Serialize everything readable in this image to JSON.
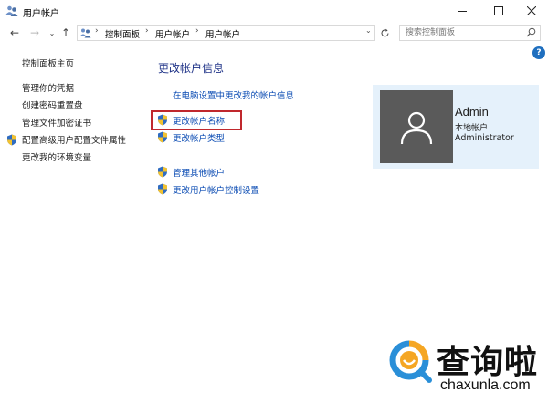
{
  "window": {
    "title": "用户帐户",
    "icons": {
      "app": "user-accounts-icon",
      "minimize": "minimize-icon",
      "maximize": "maximize-icon",
      "close": "close-icon"
    }
  },
  "address_bar": {
    "breadcrumbs": [
      "控制面板",
      "用户帐户",
      "用户帐户"
    ],
    "search_placeholder": "搜索控制面板"
  },
  "sidebar": {
    "home_link": "控制面板主页",
    "items": [
      {
        "label": "管理你的凭据",
        "shield": false
      },
      {
        "label": "创建密码重置盘",
        "shield": false
      },
      {
        "label": "管理文件加密证书",
        "shield": false
      },
      {
        "label": "配置高级用户配置文件属性",
        "shield": true
      },
      {
        "label": "更改我的环境变量",
        "shield": false
      }
    ]
  },
  "main": {
    "title": "更改帐户信息",
    "pc_settings_link": "在电脑设置中更改我的帐户信息",
    "links": [
      {
        "label": "更改帐户名称",
        "shield": true,
        "highlighted": true
      },
      {
        "label": "更改帐户类型",
        "shield": true,
        "highlighted": false
      }
    ],
    "other_links": [
      {
        "label": "管理其他帐户",
        "shield": true
      },
      {
        "label": "更改用户帐户控制设置",
        "shield": true
      }
    ]
  },
  "account": {
    "name": "Admin",
    "type": "本地帐户",
    "role": "Administrator"
  },
  "watermark": {
    "chinese": "查询啦",
    "domain": "chaxunla.com"
  },
  "colors": {
    "accent_link": "#0a4bb3",
    "title_blue": "#1e3287",
    "highlight_red": "#c0282d",
    "card_bg": "#e5f1fb",
    "avatar_bg": "#5a5a5a",
    "watermark_orange": "#f5a623",
    "watermark_blue": "#2a8fd8"
  }
}
